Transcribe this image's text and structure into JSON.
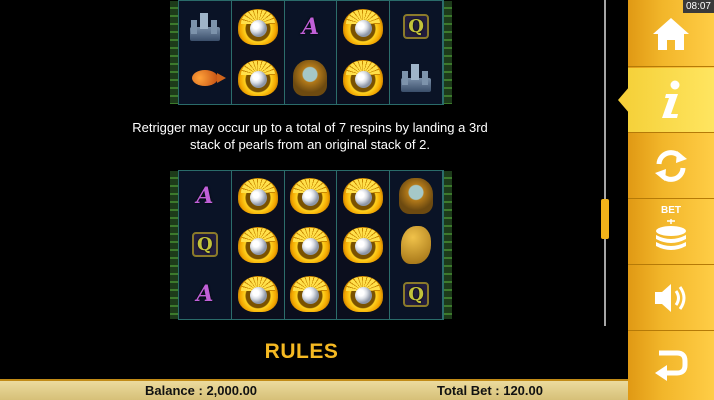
{
  "description": {
    "line1": "Retrigger may occur up to a total of 7 respins by landing a 3rd",
    "line2": "stack of pearls from an original stack of 2."
  },
  "section_heading": "RULES",
  "bottom_bar": {
    "balance_label": "Balance :",
    "balance_value": "2,000.00",
    "total_bet_label": "Total Bet :",
    "total_bet_value": "120.00"
  },
  "status": {
    "clock": "08:07"
  },
  "side_menu": {
    "items": [
      {
        "icon": "home-icon"
      },
      {
        "icon": "info-icon",
        "active": true
      },
      {
        "icon": "refresh-icon"
      },
      {
        "icon": "bet-coins-icon",
        "label": "BET"
      },
      {
        "icon": "sound-icon"
      },
      {
        "icon": "return-icon"
      }
    ]
  },
  "reels_top": [
    [
      "castle",
      "fish"
    ],
    [
      "pearl",
      "pearl"
    ],
    [
      "A",
      "diver"
    ],
    [
      "pearl",
      "pearl"
    ],
    [
      "Q",
      "castle"
    ]
  ],
  "reels_bottom": [
    [
      "A",
      "Q",
      "A"
    ],
    [
      "pearl",
      "pearl",
      "pearl"
    ],
    [
      "pearl",
      "pearl",
      "pearl"
    ],
    [
      "pearl",
      "pearl",
      "pearl"
    ],
    [
      "diver",
      "seahorse",
      "Q"
    ]
  ],
  "colors": {
    "accent": "#f5b922",
    "menu": "#f2b62a",
    "bar": "#eedea2"
  }
}
